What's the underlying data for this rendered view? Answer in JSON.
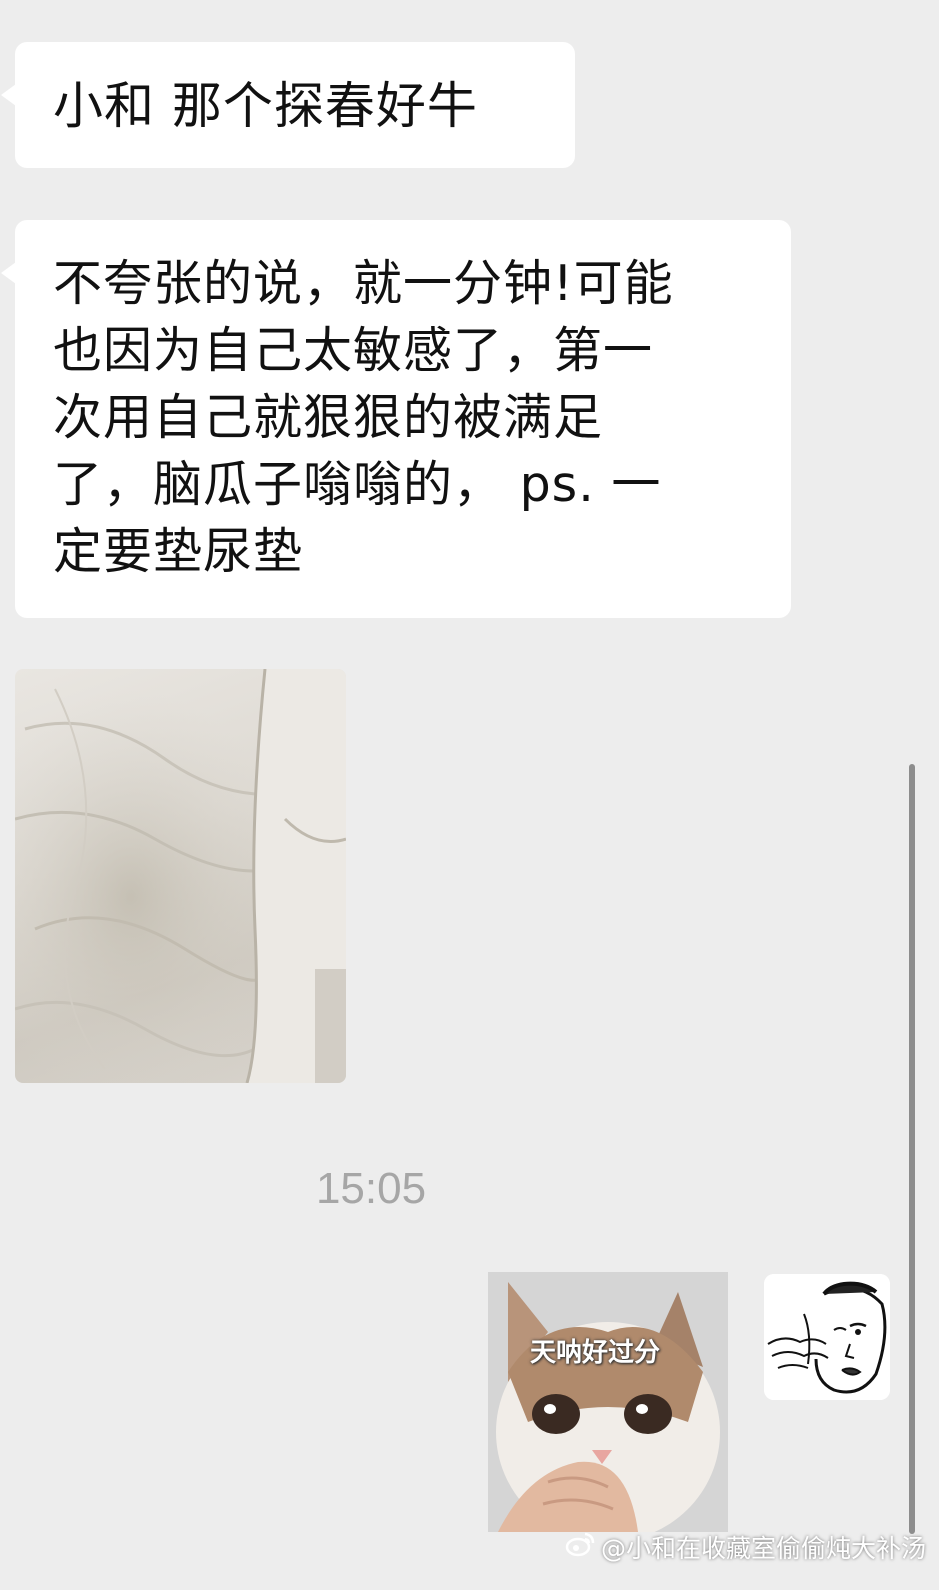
{
  "chat": {
    "messages": [
      {
        "sender": "other",
        "lines": [
          "小和 那个探春好牛"
        ]
      },
      {
        "sender": "other",
        "lines": [
          "不夸张的说，就一分钟!可能",
          "也因为自己太敏感了，第一",
          "次用自己就狠狠的被满足",
          "了，脑瓜子嗡嗡的，  ps. 一",
          "定要垫尿垫"
        ]
      }
    ],
    "timestamp": "15:05",
    "sticker": {
      "caption": "天呐好过分"
    }
  },
  "watermark": {
    "icon": "weibo-icon",
    "text": "@小和在收藏室偷偷炖大补汤"
  },
  "colors": {
    "background": "#ededed",
    "bubble": "#ffffff",
    "text": "#111111",
    "timestamp": "#a6a6a6"
  }
}
